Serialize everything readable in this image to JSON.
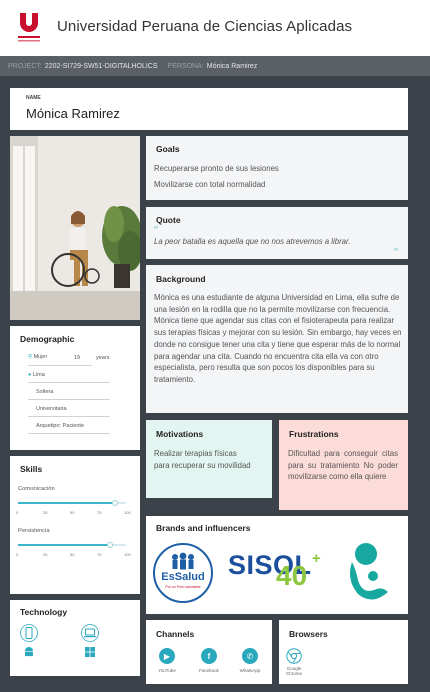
{
  "header": {
    "title": "Universidad Peruana de Ciencias Aplicadas"
  },
  "projbar": {
    "project_label": "PROJECT:",
    "project_value": "2202-SI729-SW51-DIGITALHOLICS",
    "persona_label": "PERSONA:",
    "persona_value": "Mónica Ramirez"
  },
  "name_card": {
    "label": "NAME",
    "value": "Mónica Ramirez"
  },
  "goals": {
    "title": "Goals",
    "items": [
      "Recuperarse pronto de sus lesiones",
      "Movilizarse con total normalidad"
    ]
  },
  "quote": {
    "title": "Quote",
    "text": "La peor batalla es aquella que no nos atrevemos a librar."
  },
  "background": {
    "title": "Background",
    "text": "Mónica es una estudiante de alguna Universidad en Lima, ella sufre de una lesión en la rodilla que no la permite movilizarse con frecuencia. Mónica tiene que agendar sus citas con el fisioterapeuta para realizar sus terapias físicas y mejorar con su lesión. Sin embargo, hay veces en donde no consigue tener una cita y tiene que esperar más de lo normal para agendar una cita. Cuando no encuentra cita ella va con otro especialista, pero resulta que son pocos los disponibles para su tratamiento."
  },
  "demographic": {
    "title": "Demographic",
    "gender": "Mujer",
    "age": "19",
    "age_unit": "years",
    "location": "Lima",
    "status": "Soltera",
    "education": "Universitaria",
    "archetype": "Arquetipo: Paciente"
  },
  "skills": {
    "title": "Skills",
    "items": [
      {
        "label": "Comunicación",
        "value": 90
      },
      {
        "label": "Persistencia",
        "value": 85
      }
    ],
    "ticks": [
      "0",
      "25",
      "50",
      "75",
      "100"
    ]
  },
  "technology": {
    "title": "Technology",
    "icons": [
      "mobile-icon",
      "laptop-icon",
      "android-icon",
      "windows-icon"
    ]
  },
  "motivations": {
    "title": "Motivations",
    "text": "Realizar terapias físicas para recuperar su movilidad",
    "bg": "#e3f5f1"
  },
  "frustrations": {
    "title": "Frustrations",
    "text": "Dificultad para conseguir citas para su tratamiento No poder movilizarse como ella quiere",
    "bg": "#fbdcd8"
  },
  "brands": {
    "title": "Brands and influencers",
    "essalud_name": "EsSalud",
    "essalud_tagline": "Por un Perú saludable",
    "sisol_name": "SISOL",
    "sisol_number": "40"
  },
  "channels": {
    "title": "Channels",
    "items": [
      "YouTube",
      "Facebook",
      "WhatsApp"
    ]
  },
  "browsers": {
    "title": "Browsers",
    "items": [
      "Google Chrome"
    ]
  },
  "colors": {
    "accent": "#2aa9be",
    "brand_red": "#c8102e",
    "essalud_blue": "#1f5fa8",
    "sisol_blue": "#1b4f9c",
    "sisol_green": "#8dc63f"
  }
}
